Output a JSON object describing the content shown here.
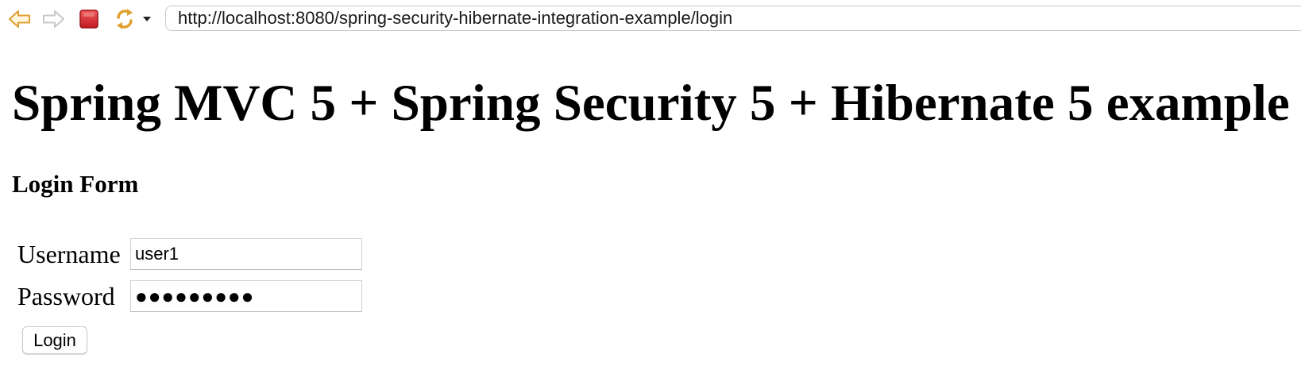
{
  "browser": {
    "url": "http://localhost:8080/spring-security-hibernate-integration-example/login",
    "icons": {
      "back": "back-arrow-icon",
      "forward": "forward-arrow-icon",
      "stop": "stop-icon",
      "reload": "reload-icon",
      "reload_menu": "chevron-down-icon"
    },
    "colors": {
      "back_arrow": "#e0a030",
      "forward_arrow": "#c8c8c8",
      "stop": "#d0262d",
      "reload": "#e0a030"
    }
  },
  "page": {
    "title": "Spring MVC 5 + Spring Security 5 + Hibernate 5 example",
    "form_heading": "Login Form",
    "username_label": "Username",
    "username_value": "user1",
    "password_label": "Password",
    "password_value": "●●●●●●●●●",
    "login_button": "Login"
  }
}
